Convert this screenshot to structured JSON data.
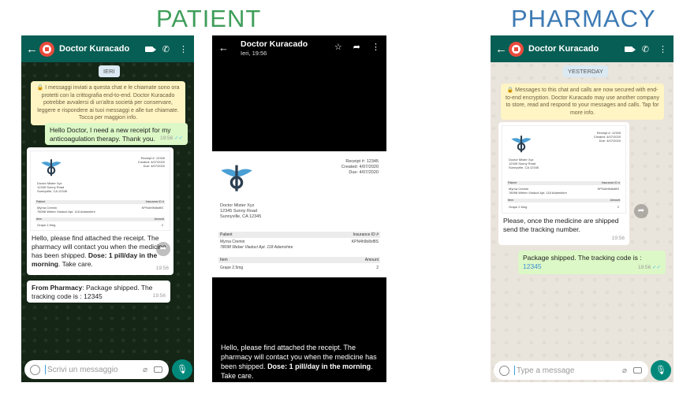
{
  "headings": {
    "patient": "PATIENT",
    "pharmacy": "PHARMACY"
  },
  "patient": {
    "contact_name": "Doctor Kuracado",
    "date_chip": "IERI",
    "notice": "🔒 I messaggi inviati a questa chat e le chiamate sono ora protetti con la crittografia end-to-end. Doctor Kuracado potrebbe avvalersi di un'altra società per conservare, leggere e rispondere ai tuoi messaggi e alle tue chiamate. Tocca per maggiori info.",
    "msg_request": "Hello Doctor, I need a new receipt for my anticoagulation therapy. Thank you.",
    "msg_request_time": "19:56",
    "msg_receipt_text_plain": "Hello, please find attached the receipt. The pharmacy will contact you when the medicine has been shipped. ",
    "msg_receipt_text_bold": "Dose: 1 pill/day in the morning",
    "msg_receipt_text_tail": ". Take care.",
    "msg_receipt_time": "19:56",
    "msg_fwd_bold": "From Pharmacy",
    "msg_fwd_text": ": Package shipped. The tracking  code is : 12345",
    "msg_fwd_time": "19:56",
    "input_placeholder": "Scrivi un messaggio"
  },
  "viewer": {
    "title": "Doctor Kuracado",
    "subtitle": "Ieri, 19:56",
    "caption_plain": "Hello, please find attached the receipt. The pharmacy will contact you when the medicine has been shipped. ",
    "caption_bold": "Dose: 1 pill/day in the morning",
    "caption_tail": ". Take care."
  },
  "receipt": {
    "receipt_no": "Receipt #: 12345",
    "created": "Created: 4/07/2020",
    "due": "Due: 4/07/2020",
    "doctor_name": "Doctor Mister Xyz",
    "doctor_street": "12345 Sunny Road",
    "doctor_city": "Sunnyville, CA 12345",
    "patient_header": "Patient",
    "insurance_header": "Insurance ID #",
    "patient_name": "Myrna Cremin",
    "patient_address": "78098 Weber Viaduct Apt. 118 Adamshire",
    "insurance_id": "KPN4h9b8sf8S",
    "item_header": "Item",
    "amount_header": "Amount",
    "item_name": "Grape 2.5mg",
    "item_amount": "2"
  },
  "pharmacy": {
    "contact_name": "Doctor Kuracado",
    "date_chip": "YESTERDAY",
    "notice": "🔒 Messages to this chat and calls are now secured with end-to-end encryption. Doctor Kuracado may use another company to store, read and respond to your messages and calls. Tap for more info.",
    "msg_receipt_text": "Please, once the medicine are shipped send the tracking number.",
    "msg_receipt_time": "19:56",
    "msg_out_text": "Package shipped. The tracking  code is : ",
    "msg_out_link": "12345",
    "msg_out_time": "19:56",
    "input_placeholder": "Type a message"
  },
  "colors": {
    "wa_header": "#075e54",
    "outgoing_bubble": "#dcf8c6",
    "patient_heading": "#3f9e5b",
    "pharmacy_heading": "#3d7ab5"
  }
}
